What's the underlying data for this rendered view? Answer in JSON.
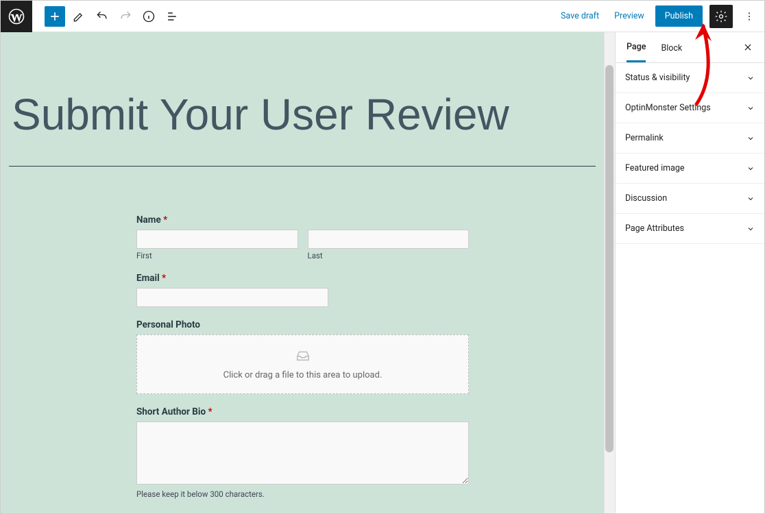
{
  "toolbar": {
    "save_draft": "Save draft",
    "preview": "Preview",
    "publish": "Publish"
  },
  "page": {
    "title": "Submit Your User Review"
  },
  "form": {
    "name_label": "Name",
    "first_hint": "First",
    "last_hint": "Last",
    "email_label": "Email",
    "photo_label": "Personal Photo",
    "upload_text": "Click or drag a file to this area to upload.",
    "bio_label": "Short Author Bio",
    "bio_hint": "Please keep it below 300 characters."
  },
  "sidebar": {
    "tab_page": "Page",
    "tab_block": "Block",
    "panels": [
      "Status & visibility",
      "OptinMonster Settings",
      "Permalink",
      "Featured image",
      "Discussion",
      "Page Attributes"
    ]
  },
  "req_mark": "*"
}
